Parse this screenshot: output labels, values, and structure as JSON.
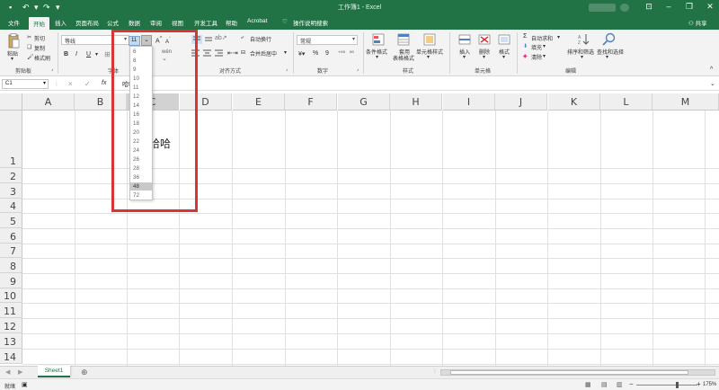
{
  "titlebar": {
    "title": "工作簿1 - Excel",
    "save_icon": "save-icon",
    "undo_icon": "undo-icon",
    "redo_icon": "redo-icon",
    "customize_icon": "customize-icon"
  },
  "tabs": [
    "文件",
    "开始",
    "插入",
    "页面布局",
    "公式",
    "数据",
    "审阅",
    "视图",
    "开发工具",
    "帮助",
    "Acrobat",
    "操作说明搜索"
  ],
  "share_label": "共享",
  "ribbon": {
    "clipboard": {
      "paste": "粘贴",
      "cut": "剪切",
      "copy": "复制",
      "format_painter": "格式刷",
      "label": "剪贴板"
    },
    "font": {
      "font_name": "等线",
      "font_size": "11",
      "bold": "B",
      "italic": "I",
      "underline": "U",
      "grow": "A",
      "shrink": "A",
      "label": "字体",
      "wen": "wén"
    },
    "alignment": {
      "wrap": "自动换行",
      "merge": "合并后居中",
      "label": "对齐方式"
    },
    "number": {
      "format": "常规",
      "percent": "%",
      "comma": "9",
      "label": "数字"
    },
    "styles": {
      "conditional": "条件格式",
      "table_line1": "套用",
      "table_line2": "表格格式",
      "cell_styles": "单元格样式",
      "label": "样式"
    },
    "cells": {
      "insert": "插入",
      "delete": "删除",
      "format": "格式",
      "label": "单元格"
    },
    "editing": {
      "autosum": "自动求和",
      "fill": "填充",
      "clear": "清除",
      "sort": "排序和筛选",
      "find": "查找和选择",
      "label": "编辑"
    }
  },
  "formula_bar": {
    "name_box": "C1",
    "fx": "fx",
    "cancel": "×",
    "confirm": "✓",
    "content": "哈哈"
  },
  "columns": [
    "A",
    "B",
    "C",
    "D",
    "E",
    "F",
    "G",
    "H",
    "I",
    "J",
    "K",
    "L",
    "M"
  ],
  "rows": [
    "1",
    "2",
    "3",
    "4",
    "5",
    "6",
    "7",
    "8",
    "9",
    "10",
    "11",
    "12",
    "13",
    "14"
  ],
  "cell_text": "哈哈",
  "font_size_options": [
    "6",
    "8",
    "9",
    "10",
    "11",
    "12",
    "14",
    "16",
    "18",
    "20",
    "22",
    "24",
    "26",
    "28",
    "36",
    "48",
    "72"
  ],
  "font_size_highlighted": "48",
  "sheet_tab": "Sheet1",
  "status": {
    "ready": "就绪",
    "zoom": "175%",
    "minus": "−",
    "plus": "+"
  },
  "colors": {
    "accent": "#217346",
    "highlight_box": "#d93535"
  }
}
